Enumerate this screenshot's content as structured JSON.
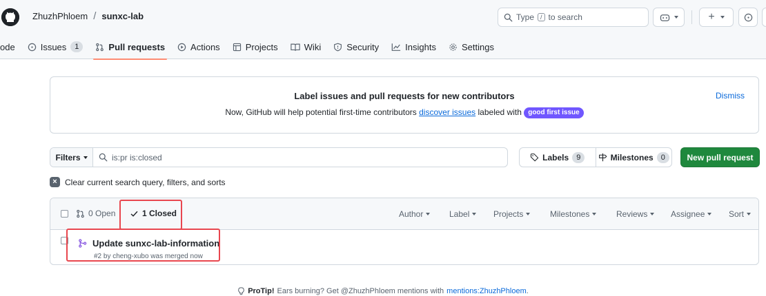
{
  "header": {
    "owner": "ZhuzhPhloem",
    "separator": "/",
    "repo": "sunxc-lab",
    "search": {
      "placeholder_prefix": "Type",
      "shortcut": "/",
      "placeholder_suffix": "to search"
    },
    "plus_label": "+"
  },
  "tabs": [
    {
      "label": "ode",
      "icon": "code-icon"
    },
    {
      "label": "Issues",
      "icon": "issue-opened-icon",
      "count": "1"
    },
    {
      "label": "Pull requests",
      "icon": "git-pull-request-icon",
      "active": true
    },
    {
      "label": "Actions",
      "icon": "play-icon"
    },
    {
      "label": "Projects",
      "icon": "table-icon"
    },
    {
      "label": "Wiki",
      "icon": "book-icon"
    },
    {
      "label": "Security",
      "icon": "shield-icon"
    },
    {
      "label": "Insights",
      "icon": "graph-icon"
    },
    {
      "label": "Settings",
      "icon": "gear-icon"
    }
  ],
  "banner": {
    "title": "Label issues and pull requests for new contributors",
    "text_before": "Now, GitHub will help potential first-time contributors",
    "link": "discover issues",
    "text_after": "labeled with",
    "label": "good first issue",
    "dismiss": "Dismiss"
  },
  "filters": {
    "button": "Filters",
    "query": "is:pr is:closed",
    "labels": "Labels",
    "labels_count": "9",
    "milestones": "Milestones",
    "milestones_count": "0",
    "new_pr": "New pull request",
    "clear": "Clear current search query, filters, and sorts"
  },
  "list": {
    "open": "0 Open",
    "closed": "1 Closed",
    "facets": [
      "Author",
      "Label",
      "Projects",
      "Milestones",
      "Reviews",
      "Assignee",
      "Sort"
    ],
    "items": [
      {
        "title": "Update sunxc-lab-information",
        "meta": "#2 by cheng-xubo was merged now"
      }
    ]
  },
  "protip": {
    "label": "ProTip!",
    "text": "Ears burning? Get @ZhuzhPhloem mentions with",
    "link": "mentions:ZhuzhPhloem",
    "end": "."
  },
  "colors": {
    "accent_green": "#1f883d",
    "link_blue": "#0969da",
    "merged_purple": "#8250df",
    "highlight_red": "#e8464e",
    "good_first_issue": "#7057ff"
  }
}
